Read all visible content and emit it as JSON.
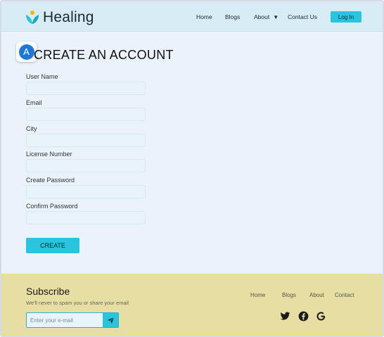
{
  "brand": {
    "name": "Healing",
    "accent": "#2bc4df",
    "footer_bg": "#e6dea2",
    "header_bg": "#d7ecf5"
  },
  "nav": {
    "items": [
      {
        "label": "Home"
      },
      {
        "label": "Blogs"
      },
      {
        "label": "About"
      },
      {
        "label": "Contact Us"
      }
    ],
    "about_caret_icon": "caret-down-icon",
    "login_label": "Log In"
  },
  "avatar": {
    "letter": "A"
  },
  "form": {
    "title": "CREATE AN ACCOUNT",
    "fields": [
      {
        "label": "User Name",
        "value": ""
      },
      {
        "label": "Email",
        "value": ""
      },
      {
        "label": "City",
        "value": ""
      },
      {
        "label": "License Number",
        "value": ""
      },
      {
        "label": "Create Password",
        "value": ""
      },
      {
        "label": "Confirm Password",
        "value": ""
      }
    ],
    "submit_label": "CREATE"
  },
  "footer": {
    "subscribe_title": "Subscribe",
    "subscribe_sub": "We'll never to spam you or share your email",
    "email_placeholder": "Enter your e-mail",
    "send_icon": "paper-plane-icon",
    "links": [
      {
        "label": "Home"
      },
      {
        "label": "Blogs"
      },
      {
        "label": "About"
      },
      {
        "label": "Contact"
      }
    ],
    "social_icons": [
      "twitter-icon",
      "facebook-icon",
      "google-icon"
    ]
  }
}
